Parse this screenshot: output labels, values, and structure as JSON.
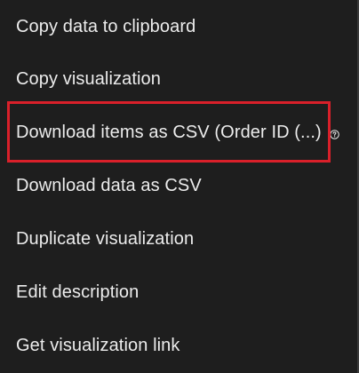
{
  "menu": {
    "items": [
      {
        "label": "Copy data to clipboard"
      },
      {
        "label": "Copy visualization"
      },
      {
        "label": "Download items as CSV (Order ID (...)",
        "icon": "help-circle-icon"
      },
      {
        "label": "Download data as CSV"
      },
      {
        "label": "Duplicate visualization"
      },
      {
        "label": "Edit description"
      },
      {
        "label": "Get visualization link"
      }
    ],
    "highlighted_index": 2
  },
  "colors": {
    "background": "#1e1e1e",
    "text": "#ececec",
    "highlight": "#d9202a"
  }
}
